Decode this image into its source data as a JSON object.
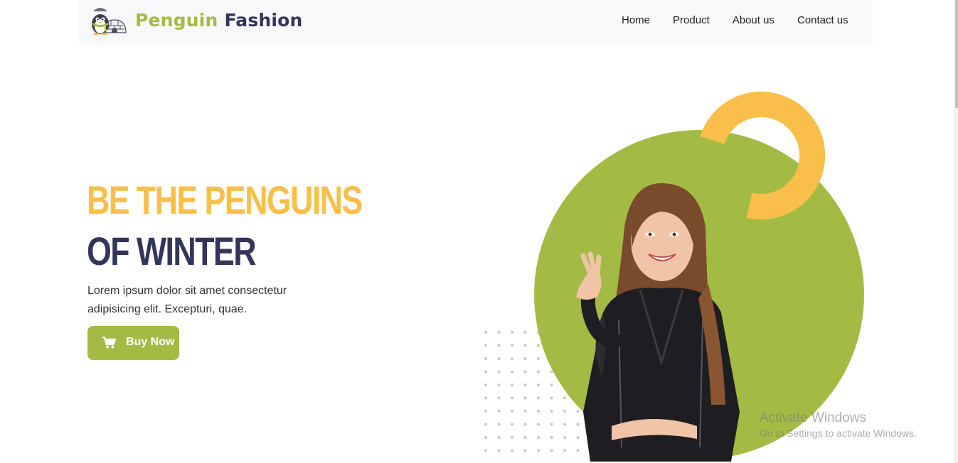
{
  "brand": {
    "name_part1": "Penguin",
    "name_part2": "Fashion",
    "logo_icon": "penguin-igloo-logo"
  },
  "nav": {
    "links": [
      "Home",
      "Product",
      "About us",
      "Contact us"
    ]
  },
  "hero": {
    "headline_line1": "BE THE PENGUINS",
    "headline_line2": "OF WINTER",
    "description": "Lorem ipsum dolor sit amet consectetur adipisicing elit. Excepturi, quae.",
    "button_label": "Buy Now",
    "button_icon": "cart-icon"
  },
  "watermark": {
    "line1": "Activate Windows",
    "line2": "Go to Settings to activate Windows."
  },
  "colors": {
    "accent_green": "#a3bb45",
    "accent_yellow": "#f9bf4a",
    "navy": "#33365a",
    "nav_background": "#f7f8fa"
  }
}
